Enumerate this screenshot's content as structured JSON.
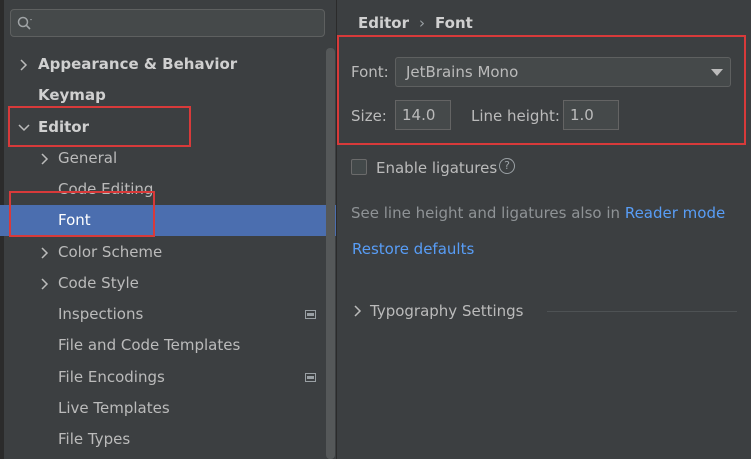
{
  "search": {
    "value": "",
    "placeholder": ""
  },
  "sidebar": {
    "items": [
      {
        "label": "Appearance & Behavior"
      },
      {
        "label": "Keymap"
      },
      {
        "label": "Editor"
      },
      {
        "label": "General"
      },
      {
        "label": "Code Editing"
      },
      {
        "label": "Font"
      },
      {
        "label": "Color Scheme"
      },
      {
        "label": "Code Style"
      },
      {
        "label": "Inspections"
      },
      {
        "label": "File and Code Templates"
      },
      {
        "label": "File Encodings"
      },
      {
        "label": "Live Templates"
      },
      {
        "label": "File Types"
      }
    ]
  },
  "breadcrumb": {
    "parent": "Editor",
    "separator": "›",
    "current": "Font"
  },
  "font_settings": {
    "font_label": "Font:",
    "font_value": "JetBrains Mono",
    "size_label": "Size:",
    "size_value": "14.0",
    "line_height_label": "Line height:",
    "line_height_value": "1.0"
  },
  "ligatures": {
    "label": "Enable ligatures",
    "checked": false,
    "help_glyph": "?"
  },
  "hint": {
    "text": "See line height and ligatures also in",
    "link": "Reader mode"
  },
  "restore_defaults": "Restore defaults",
  "typography": {
    "label": "Typography Settings"
  },
  "colors": {
    "selection": "#4b6eaf",
    "link": "#589df6",
    "highlight_box": "#d83a3a",
    "background": "#3c3f41"
  }
}
